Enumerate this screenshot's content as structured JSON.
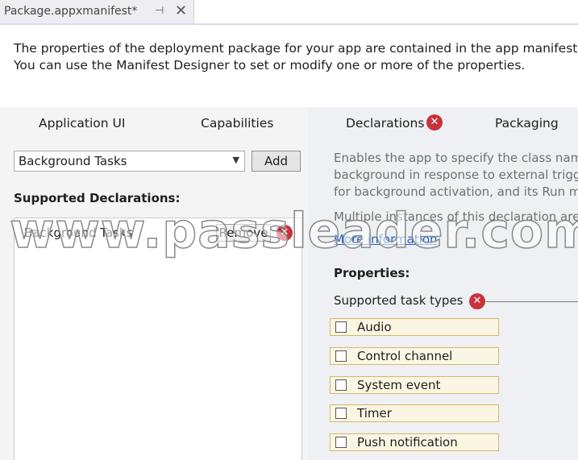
{
  "tab": {
    "title": "Package.appxmanifest*",
    "pin_icon": "pin-icon",
    "close_icon": "close-icon"
  },
  "description": {
    "line1": "The properties of the deployment package for your app are contained in the app manifest file",
    "line2": "You can use the Manifest Designer to set or modify one or more of the properties."
  },
  "designer_tabs": [
    {
      "label": "Application UI"
    },
    {
      "label": "Capabilities"
    },
    {
      "label": "Declarations",
      "has_error": true
    },
    {
      "label": "Packaging"
    }
  ],
  "available_declarations": {
    "selected": "Background Tasks",
    "add_label": "Add"
  },
  "supported_declarations": {
    "label": "Supported Declarations:",
    "items": [
      {
        "label": "Background Tasks",
        "remove_label": "Remove",
        "has_error": true
      }
    ]
  },
  "declaration_info": {
    "line1": "Enables the app to specify the class nam",
    "line2": "background in response to external trigg",
    "line3": "for background activation, and its Run m",
    "line4": "Multiple instances of this declaration are",
    "more_info": "More information"
  },
  "properties": {
    "label": "Properties:",
    "task_types_label": "Supported task types",
    "task_types": [
      {
        "label": "Audio",
        "checked": false
      },
      {
        "label": "Control channel",
        "checked": false
      },
      {
        "label": "System event",
        "checked": false
      },
      {
        "label": "Timer",
        "checked": false
      },
      {
        "label": "Push notification",
        "checked": false
      }
    ]
  },
  "watermark": "www.passleader.com",
  "colors": {
    "error": "#c8323c",
    "link": "#1e65c8",
    "highlight_border": "#d4b969"
  }
}
